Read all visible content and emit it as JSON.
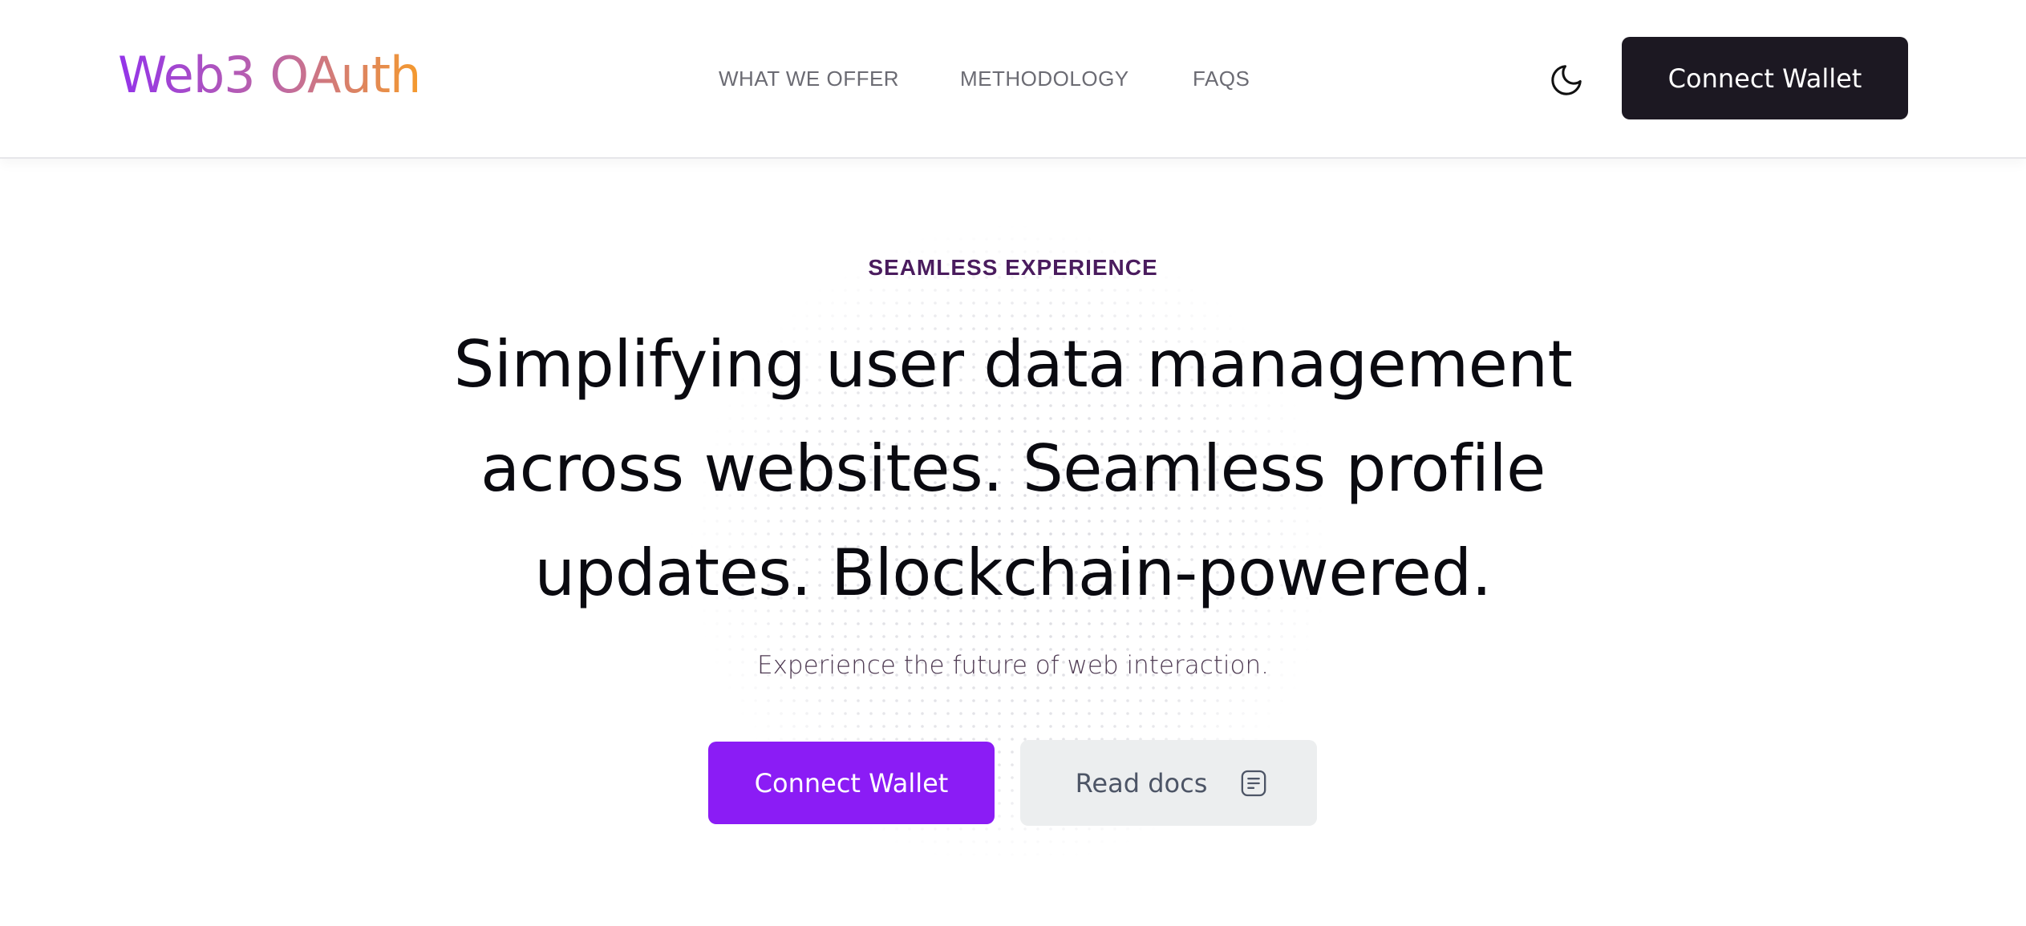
{
  "header": {
    "logo_text": "Web3 OAuth",
    "nav": [
      {
        "label": "WHAT WE OFFER"
      },
      {
        "label": "METHODOLOGY"
      },
      {
        "label": "FAQS"
      }
    ],
    "theme_toggle_icon": "moon-icon",
    "connect_label": "Connect Wallet"
  },
  "hero": {
    "eyebrow": "SEAMLESS EXPERIENCE",
    "headline": "Simplifying user data management across websites. Seamless profile updates. Blockchain-powered.",
    "subtitle": "Experience the future of web interaction.",
    "primary_cta_label": "Connect Wallet",
    "secondary_cta_label": "Read docs",
    "secondary_cta_icon": "document-icon"
  },
  "colors": {
    "logo_gradient_start": "#9333ea",
    "logo_gradient_end": "#f59a2c",
    "primary": "#8b1cf5",
    "dark_button": "#1c1822",
    "eyebrow": "#4a1c5e"
  }
}
